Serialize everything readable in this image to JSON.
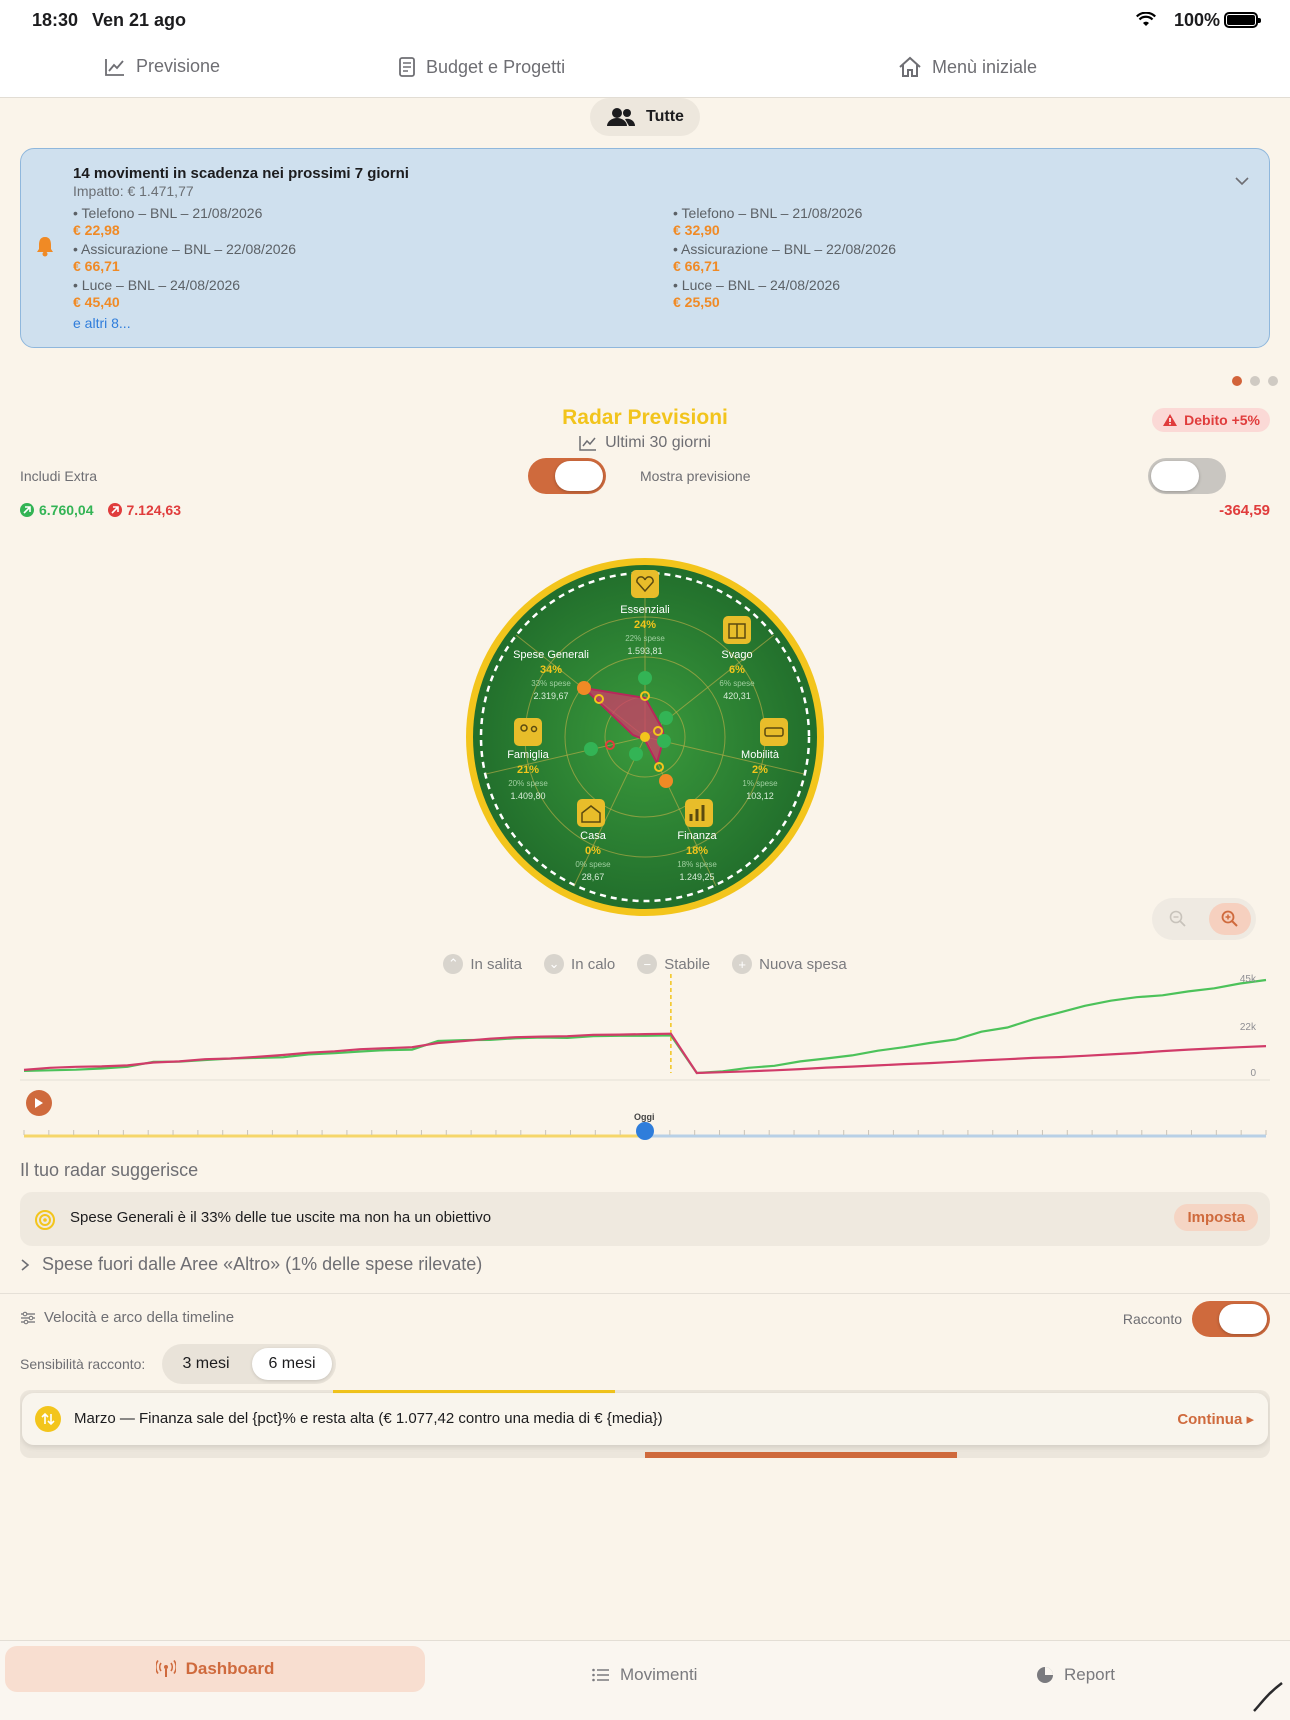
{
  "status": {
    "time": "18:30",
    "date": "Ven 21 ago",
    "battery": "100%"
  },
  "tabs": {
    "previsione": "Previsione",
    "budget": "Budget e Progetti",
    "menu": "Menù iniziale"
  },
  "filter": {
    "label": "Tutte"
  },
  "alert": {
    "title": "14 movimenti in scadenza nei prossimi 7 giorni",
    "impact": "Impatto: € 1.471,77",
    "left": [
      {
        "label": "• Telefono – BNL – 21/08/2026",
        "amount": "€ 22,98"
      },
      {
        "label": "• Assicurazione – BNL – 22/08/2026",
        "amount": "€ 66,71"
      },
      {
        "label": "• Luce – BNL – 24/08/2026",
        "amount": "€ 45,40"
      }
    ],
    "right": [
      {
        "label": "• Telefono – BNL – 21/08/2026",
        "amount": "€ 32,90"
      },
      {
        "label": "• Assicurazione – BNL – 22/08/2026",
        "amount": "€ 66,71"
      },
      {
        "label": "• Luce – BNL – 24/08/2026",
        "amount": "€ 25,50"
      }
    ],
    "more": "e altri 8..."
  },
  "radar": {
    "title": "Radar Previsioni",
    "period": "Ultimi 30 giorni",
    "debt_badge": "Debito +5%",
    "include_extra": "Includi Extra",
    "show_forecast": "Mostra previsione",
    "include_extra_on": true,
    "show_forecast_on": false,
    "income": "6.760,04",
    "expense": "7.124,63",
    "net": "-364,59",
    "categories": [
      {
        "name": "Essenziali",
        "pct": "24%",
        "spese": "22% spese",
        "amount": "1.593,81"
      },
      {
        "name": "Svago",
        "pct": "6%",
        "spese": "6% spese",
        "amount": "420,31"
      },
      {
        "name": "Mobilità",
        "pct": "2%",
        "spese": "1% spese",
        "amount": "103,12"
      },
      {
        "name": "Finanza",
        "pct": "18%",
        "spese": "18% spese",
        "amount": "1.249,25"
      },
      {
        "name": "Casa",
        "pct": "0%",
        "spese": "0% spese",
        "amount": "28,67"
      },
      {
        "name": "Famiglia",
        "pct": "21%",
        "spese": "20% spese",
        "amount": "1.409,80"
      },
      {
        "name": "Spese Generali",
        "pct": "34%",
        "spese": "33% spese",
        "amount": "2.319,67"
      }
    ]
  },
  "legend": {
    "up": "In salita",
    "down": "In calo",
    "stable": "Stabile",
    "new": "Nuova spesa"
  },
  "timeline": {
    "today_label": "Oggi",
    "ticks": [
      "45k",
      "22k",
      "0"
    ],
    "colors": {
      "income": "#4cc25a",
      "expense": "#d13b69",
      "today": "#f2c41c"
    }
  },
  "chart_data": {
    "type": "line",
    "ylim": [
      0,
      45000
    ],
    "yticks": [
      "45k",
      "22k",
      "0"
    ],
    "today_index": 25,
    "series": [
      {
        "values": [
          1000,
          1300,
          1600,
          2200,
          3000,
          5400,
          5500,
          6300,
          7000,
          7300,
          7600,
          9000,
          9600,
          10400,
          11100,
          11300,
          15500,
          15900,
          16000,
          16800,
          17200,
          17000,
          17800,
          18000,
          18000,
          18200,
          0,
          800,
          2500,
          3500,
          5600,
          7000,
          8500,
          10800,
          12500,
          14500,
          16200,
          20000,
          22000,
          26000,
          29200,
          32500,
          35000,
          36700,
          37600,
          39500,
          41000,
          43300,
          45000
        ]
      },
      {
        "values": [
          1500,
          2500,
          3000,
          3200,
          3700,
          5100,
          5600,
          6700,
          7000,
          7800,
          8700,
          9800,
          10500,
          11500,
          12000,
          12500,
          14500,
          15500,
          16600,
          17300,
          17600,
          17800,
          18500,
          18600,
          18800,
          19000,
          0,
          400,
          800,
          1300,
          1900,
          2600,
          3100,
          3700,
          4300,
          4800,
          5400,
          6100,
          6700,
          7300,
          7700,
          8300,
          9000,
          9700,
          10600,
          11300,
          11900,
          12500,
          13000
        ]
      }
    ]
  },
  "suggestions": {
    "heading": "Il tuo radar suggerisce",
    "item": "Spese Generali è il 33% delle tue uscite ma non ha un obiettivo",
    "button": "Imposta",
    "disclosure": "Spese fuori dalle Aree «Altro» (1% delle spese rilevate)"
  },
  "settings": {
    "speed_label": "Velocità e arco della timeline",
    "story_label": "Racconto",
    "story_on": true,
    "sensitivity_label": "Sensibilità racconto:",
    "opt_3": "3 mesi",
    "opt_6": "6 mesi",
    "selected": "6 mesi"
  },
  "story": {
    "text": "Marzo — Finanza sale del {pct}% e resta alta (€ 1.077,42 contro una media di € {media})",
    "continue": "Continua ▸"
  },
  "bottom_tabs": {
    "dashboard": "Dashboard",
    "movimenti": "Movimenti",
    "report": "Report"
  }
}
